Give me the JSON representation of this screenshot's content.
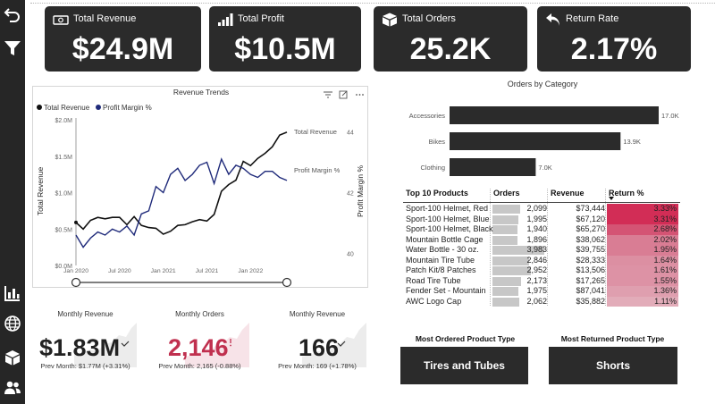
{
  "kpis": [
    {
      "title": "Total Revenue",
      "value": "$24.9M",
      "icon": "money-icon"
    },
    {
      "title": "Total Profit",
      "value": "$10.5M",
      "icon": "bar-chart-icon"
    },
    {
      "title": "Total Orders",
      "value": "25.2K",
      "icon": "box-icon"
    },
    {
      "title": "Return Rate",
      "value": "2.17%",
      "icon": "return-arrow-icon"
    }
  ],
  "trend": {
    "title": "Revenue Trends",
    "legend": [
      "Total Revenue",
      "Profit Margin %"
    ],
    "ylabel_left": "Total Revenue",
    "ylabel_right": "Profit Margin %",
    "yticks_left": [
      "$2.0M",
      "$1.5M",
      "$1.0M",
      "$0.5M",
      "$0.0M"
    ],
    "yticks_right": [
      "44",
      "42",
      "40"
    ],
    "xticks": [
      "Jan 2020",
      "Jul 2020",
      "Jan 2021",
      "Jul 2021",
      "Jan 2022"
    ],
    "series_label_revenue": "Total Revenue",
    "series_label_margin": "Profit Margin %"
  },
  "categories": {
    "title": "Orders by Category"
  },
  "table": {
    "headers": [
      "Top 10 Products",
      "Orders",
      "Revenue",
      "Return %"
    ],
    "rows": [
      {
        "product": "Sport-100 Helmet, Red",
        "orders": "2,099",
        "revenue": "$73,444",
        "ret": "3.33%"
      },
      {
        "product": "Sport-100 Helmet, Blue",
        "orders": "1,995",
        "revenue": "$67,120",
        "ret": "3.31%"
      },
      {
        "product": "Sport-100 Helmet, Black",
        "orders": "1,940",
        "revenue": "$65,270",
        "ret": "2.68%"
      },
      {
        "product": "Mountain Bottle Cage",
        "orders": "1,896",
        "revenue": "$38,062",
        "ret": "2.02%"
      },
      {
        "product": "Water Bottle - 30 oz.",
        "orders": "3,983",
        "revenue": "$39,755",
        "ret": "1.95%"
      },
      {
        "product": "Mountain Tire Tube",
        "orders": "2,846",
        "revenue": "$28,333",
        "ret": "1.64%"
      },
      {
        "product": "Patch Kit/8 Patches",
        "orders": "2,952",
        "revenue": "$13,506",
        "ret": "1.61%"
      },
      {
        "product": "Road Tire Tube",
        "orders": "2,173",
        "revenue": "$17,265",
        "ret": "1.55%"
      },
      {
        "product": "Fender Set - Mountain",
        "orders": "1,975",
        "revenue": "$87,041",
        "ret": "1.36%"
      },
      {
        "product": "AWC Logo Cap",
        "orders": "2,062",
        "revenue": "$35,882",
        "ret": "1.11%"
      }
    ]
  },
  "monthly": [
    {
      "title": "Monthly Revenue",
      "value": "$1.83M",
      "sub": "Prev Month: $1.77M (+3.31%)",
      "color": "#222222"
    },
    {
      "title": "Monthly Orders",
      "value": "2,146",
      "sub": "Prev Month: 2,165 (-0.88%)",
      "color": "#c0304f"
    },
    {
      "title": "Monthly Revenue",
      "value": "166",
      "sub": "Prev Month: 169 (+1.78%)",
      "color": "#222222"
    }
  ],
  "product_types": [
    {
      "title": "Most Ordered Product Type",
      "value": "Tires and Tubes"
    },
    {
      "title": "Most Returned Product Type",
      "value": "Shorts"
    }
  ],
  "chart_data": [
    {
      "type": "bar",
      "title": "Orders by Category",
      "categories": [
        "Accessories",
        "Bikes",
        "Clothing"
      ],
      "values": [
        17000,
        13900,
        7000
      ],
      "data_labels": [
        "17.0K",
        "13.9K",
        "7.0K"
      ],
      "xlim": [
        0,
        17000
      ]
    },
    {
      "type": "line",
      "title": "Revenue Trends",
      "x": [
        "Jan 2020",
        "Feb 2020",
        "Mar 2020",
        "Apr 2020",
        "May 2020",
        "Jun 2020",
        "Jul 2020",
        "Aug 2020",
        "Sep 2020",
        "Oct 2020",
        "Nov 2020",
        "Dec 2020",
        "Jan 2021",
        "Feb 2021",
        "Mar 2021",
        "Apr 2021",
        "May 2021",
        "Jun 2021",
        "Jul 2021",
        "Aug 2021",
        "Sep 2021",
        "Oct 2021",
        "Nov 2021",
        "Dec 2021",
        "Jan 2022",
        "Feb 2022",
        "Mar 2022",
        "Apr 2022",
        "May 2022",
        "Jun 2022"
      ],
      "xlabel": "",
      "series": [
        {
          "name": "Total Revenue",
          "axis": "left",
          "color": "#111111",
          "values": [
            0.59,
            0.5,
            0.62,
            0.66,
            0.64,
            0.66,
            0.66,
            0.56,
            0.67,
            0.55,
            0.52,
            0.51,
            0.43,
            0.47,
            0.55,
            0.56,
            0.6,
            0.63,
            0.61,
            0.7,
            1.02,
            1.11,
            1.17,
            1.43,
            1.37,
            1.47,
            1.54,
            1.63,
            1.79,
            1.83
          ]
        },
        {
          "name": "Profit Margin %",
          "axis": "right",
          "color": "#1f2a7a",
          "values": [
            40.6,
            40.2,
            40.5,
            40.7,
            40.6,
            40.8,
            40.7,
            40.9,
            40.6,
            41.3,
            41.4,
            42.2,
            42.0,
            42.6,
            42.8,
            42.4,
            42.6,
            42.9,
            43.0,
            42.3,
            43.1,
            42.6,
            42.9,
            42.8,
            42.6,
            42.5,
            42.7,
            42.7,
            42.5,
            42.4
          ]
        }
      ],
      "ylim_left": [
        0,
        2.0
      ],
      "ylabel_left": "Total Revenue",
      "ylim_right": [
        39.6,
        44.4
      ],
      "ylabel_right": "Profit Margin %"
    }
  ],
  "colors": {
    "card_dark": "#2b2b2b",
    "nav": "#262626",
    "revenue_line": "#111111",
    "margin_line": "#1f2a7a",
    "accent_red": "#c0304f"
  }
}
